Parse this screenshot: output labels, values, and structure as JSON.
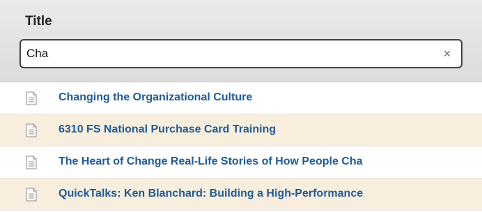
{
  "column": {
    "title": "Title"
  },
  "filter": {
    "value": "Cha",
    "clear_label": "×"
  },
  "rows": [
    {
      "title": "Changing the Organizational Culture",
      "icon": "document-icon"
    },
    {
      "title": "6310 FS National Purchase Card Training",
      "icon": "document-icon"
    },
    {
      "title": "The Heart of Change Real-Life Stories of How People Cha",
      "icon": "document-icon"
    },
    {
      "title": "QuickTalks: Ken Blanchard: Building a High-Performance",
      "icon": "document-icon"
    }
  ],
  "colors": {
    "link": "#1f5b97",
    "alt_row": "#f8eedd",
    "header_bg": "#e2e2e2"
  }
}
